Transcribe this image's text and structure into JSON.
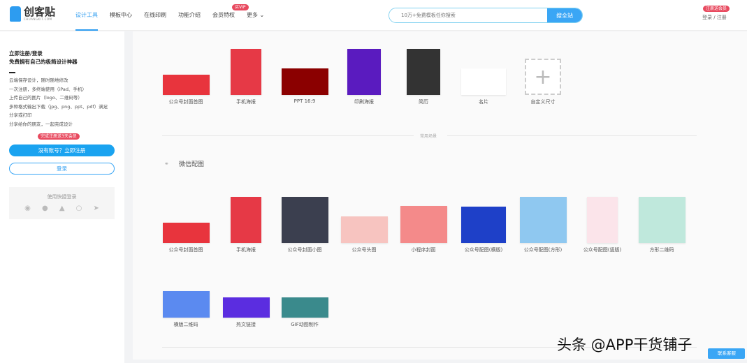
{
  "header": {
    "logo_text": "创客贴",
    "logo_sub": "CHUANGKIT.COM",
    "nav": [
      {
        "label": "设计工具",
        "active": true
      },
      {
        "label": "模板中心"
      },
      {
        "label": "在线印刷"
      },
      {
        "label": "功能介绍"
      },
      {
        "label": "会员特权"
      },
      {
        "label": "更多 ⌄"
      }
    ],
    "vip_badge": "买VIP",
    "search_placeholder": "10万+免费模板任你搜索",
    "search_button": "搜全站",
    "register_badge": "注册送会员",
    "login_register": "登录 / 注册"
  },
  "sidebar": {
    "title1": "立即注册/登录",
    "title2": "免费拥有自己的极简设计神器",
    "features": [
      "云端保存设计，随时随地修改",
      "一次注册，多终端使用（iPad、手机）",
      "上传自己的图片（logo、二维码等）",
      "多种格式输出下载（jpg、png、ppt、pdf）满足",
      "分享或打印",
      "分享给你的朋友，一起完成设计"
    ],
    "promo_badge": "完成注册送3天会员",
    "register_button": "没有账号？立即注册",
    "login_button": "登录",
    "quick_login_label": "使用快捷登录",
    "quick_icons": [
      "weibo-icon",
      "wechat-icon",
      "qq-icon",
      "chat-icon",
      "dingtalk-icon"
    ]
  },
  "main": {
    "row1": [
      {
        "label": "公众号封面首图",
        "color": "#e8343d"
      },
      {
        "label": "手机海报",
        "color": "#e63946"
      },
      {
        "label": "PPT 16:9",
        "color": "#8b0000"
      },
      {
        "label": "印刷海报",
        "color": "#5a1bbf"
      },
      {
        "label": "简历",
        "color": "#333333"
      },
      {
        "label": "名片",
        "color": "#ffffff"
      },
      {
        "label": "自定义尺寸",
        "color": "#ffffff"
      }
    ],
    "section_caption": "常用场景",
    "section_title": "微信配图",
    "row2": [
      {
        "label": "公众号封面首图",
        "color": "#e8343d"
      },
      {
        "label": "手机海报",
        "color": "#e63946"
      },
      {
        "label": "公众号封面小图",
        "color": "#3b3f4f"
      },
      {
        "label": "公众号头图",
        "color": "#f7c4c0"
      },
      {
        "label": "小程序封面",
        "color": "#f48a8a"
      },
      {
        "label": "公众号配图(横版)",
        "color": "#1e40c8"
      },
      {
        "label": "公众号配图(方形)",
        "color": "#8fc8f0"
      },
      {
        "label": "公众号配图(竖版)",
        "color": "#fbe4ea"
      },
      {
        "label": "方形二维码",
        "color": "#bfe8dc"
      }
    ],
    "row3": [
      {
        "label": "横版二维码",
        "color": "#5b8af0"
      },
      {
        "label": "热文链接",
        "color": "#5b2de0"
      },
      {
        "label": "GIF动图制作",
        "color": "#3a8a8c"
      }
    ]
  },
  "watermark": "头条 @APP干货铺子",
  "support_button": "联系客服"
}
